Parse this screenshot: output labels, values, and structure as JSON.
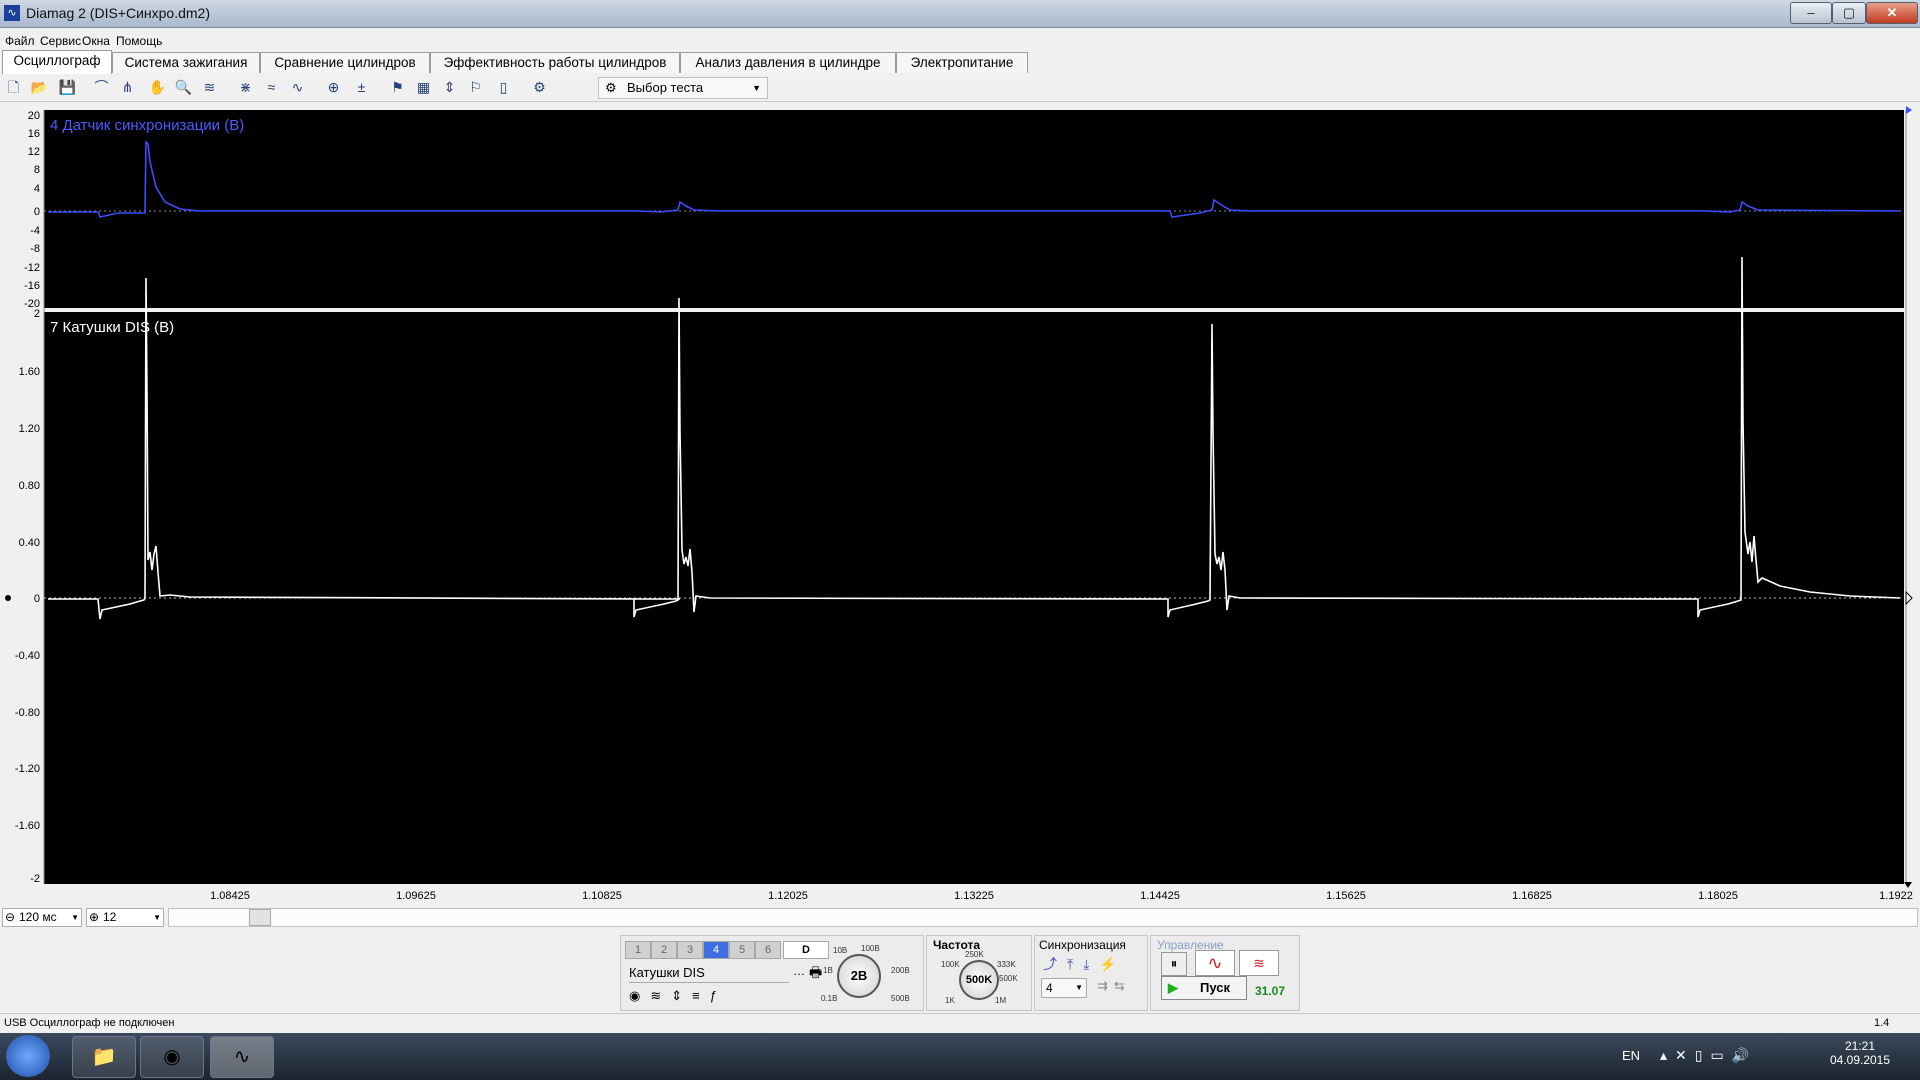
{
  "window": {
    "title": "Diamag 2 (DIS+Синхро.dm2)",
    "app_icon": "waveform-icon",
    "min_label": "‒",
    "max_label": "▢",
    "close_label": "✕"
  },
  "menu": [
    {
      "label": "Файл"
    },
    {
      "label": "Сервис"
    },
    {
      "label": "Окна"
    },
    {
      "label": "Помощь"
    }
  ],
  "tabs": [
    {
      "label": "Осциллограф",
      "active": true
    },
    {
      "label": "Система зажигания"
    },
    {
      "label": "Сравнение цилиндров"
    },
    {
      "label": "Эффективность работы цилиндров"
    },
    {
      "label": "Анализ давления в цилиндре"
    },
    {
      "label": "Электропитание"
    }
  ],
  "toolbar": {
    "icons": [
      "new-file-icon",
      "open-folder-icon",
      "save-icon",
      "cursor-icon",
      "cursor-pair-icon",
      "hand-pan-icon",
      "zoom-icon",
      "autoscale-icon",
      "grid-icon",
      "filter-icon",
      "overlay-icon",
      "measure-icon",
      "zero-icon",
      "marker-flag-icon",
      "table-icon",
      "split-icon",
      "bookmark-icon",
      "report-icon",
      "auto-settings-icon"
    ],
    "test_select_label": "Выбор теста"
  },
  "scope": {
    "accent_sync": "#3a4dff",
    "accent_coil": "#ffffff",
    "channel_top": {
      "label": "4 Датчик синхронизации (В)",
      "y_ticks": [
        "20",
        "16",
        "12",
        "8",
        "4",
        "0",
        "-4",
        "-8",
        "-12",
        "-16",
        "-20"
      ]
    },
    "channel_bottom": {
      "label": "7 Катушки DIS (В)",
      "y_ticks": [
        "2",
        "1.60",
        "1.20",
        "0.80",
        "0.40",
        "0",
        "-0.40",
        "-0.80",
        "-1.20",
        "-1.60",
        "-2"
      ]
    },
    "x_ticks": [
      "1.08425",
      "1.09625",
      "1.10825",
      "1.12025",
      "1.13225",
      "1.14425",
      "1.15625",
      "1.16825",
      "1.18025",
      "1.1922"
    ]
  },
  "controls": {
    "timebase": "120 мс",
    "zoom": "12",
    "channels": [
      "1",
      "2",
      "3",
      "4",
      "5",
      "6"
    ],
    "active_channel": "4",
    "digital_btn": "D",
    "channel_name": "Катушки DIS",
    "volt_knob": "2В",
    "volt_scale": [
      "10В",
      "100В",
      "1В",
      "200В",
      "0.1В",
      "500В"
    ],
    "freq_title": "Частота",
    "freq_knob": "500K",
    "freq_scale": [
      "250K",
      "100K",
      "333K",
      "500K",
      "1K",
      "1M"
    ],
    "sync_title": "Синхронизация",
    "sync_channel": "4",
    "control_title": "Управление",
    "run_label": "Пуск",
    "freq_value": "31.07"
  },
  "status": {
    "text": "USB Осциллограф не подключен",
    "right": "1.4"
  },
  "taskbar": {
    "lang": "EN",
    "time": "21:21",
    "date": "04.09.2015"
  }
}
